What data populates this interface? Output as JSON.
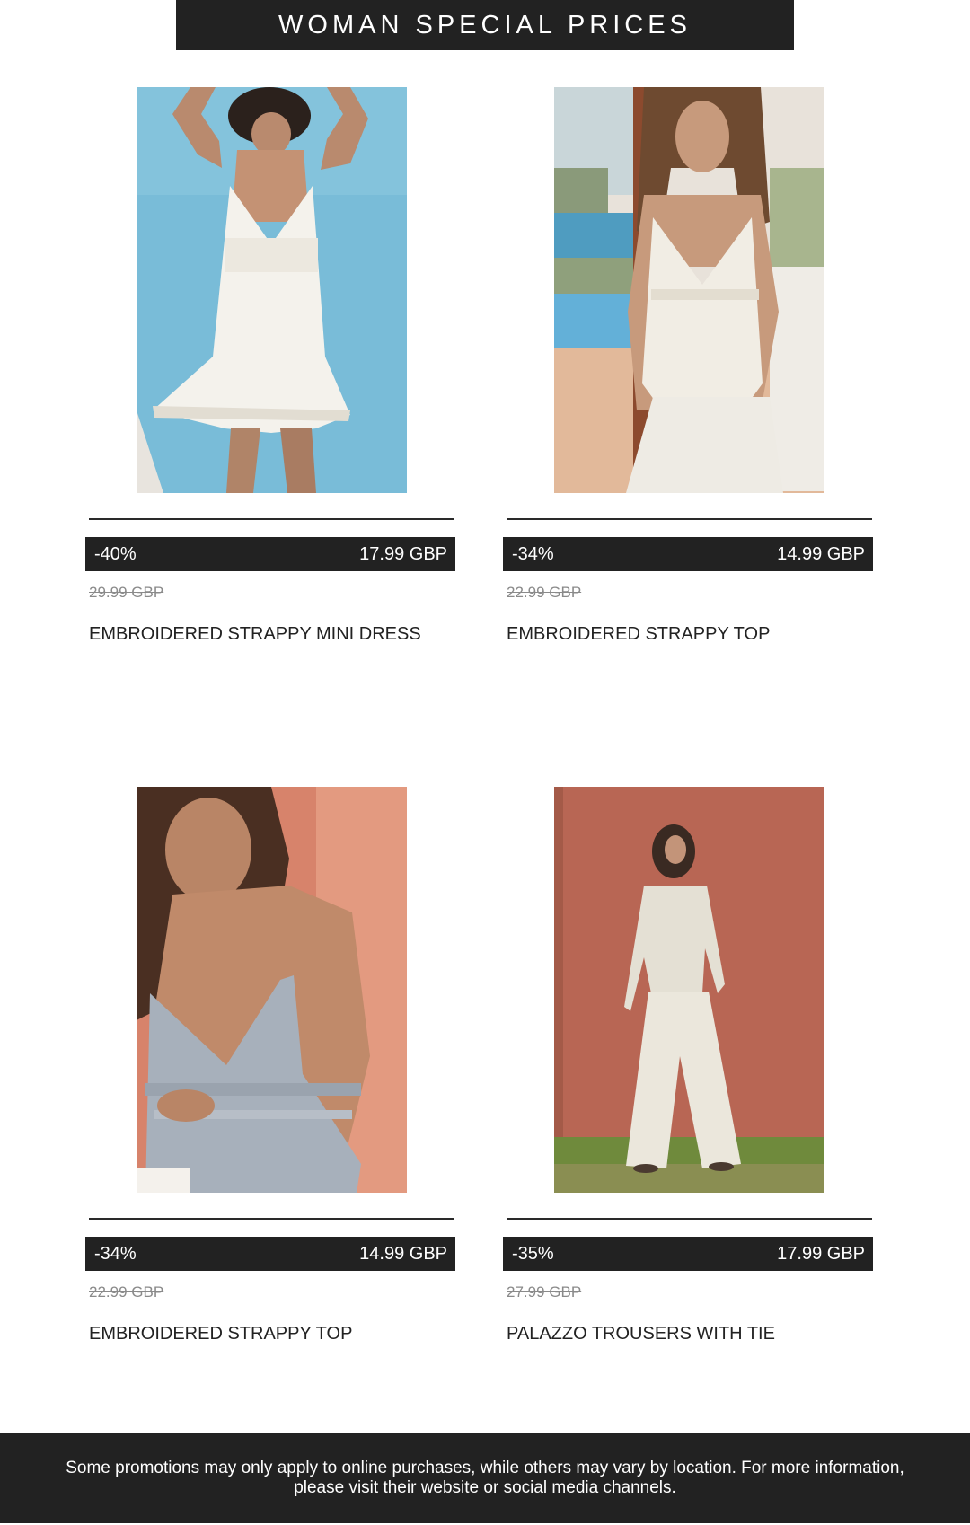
{
  "header": {
    "title": "WOMAN SPECIAL PRICES"
  },
  "products": [
    {
      "discount": "-40%",
      "price": "17.99 GBP",
      "old_price": "29.99 GBP",
      "name": "EMBROIDERED STRAPPY MINI DRESS",
      "image_alt": "Woman in white embroidered strappy mini dress"
    },
    {
      "discount": "-34%",
      "price": "14.99 GBP",
      "old_price": "22.99 GBP",
      "name": "EMBROIDERED STRAPPY TOP",
      "image_alt": "Woman in white embroidered strappy top and white trousers"
    },
    {
      "discount": "-34%",
      "price": "14.99 GBP",
      "old_price": "22.99 GBP",
      "name": "EMBROIDERED STRAPPY TOP",
      "image_alt": "Woman in blue-grey embroidered strappy top"
    },
    {
      "discount": "-35%",
      "price": "17.99 GBP",
      "old_price": "27.99 GBP",
      "name": "PALAZZO TROUSERS WITH TIE",
      "image_alt": "Woman in beige wrap top and palazzo trousers"
    }
  ],
  "footer": {
    "text": "Some promotions may only apply to online purchases, while others may vary by location. For more information,\nplease visit their website or social media channels."
  },
  "colors": {
    "banner_background": "#222222",
    "banner_text": "#ffffff",
    "old_price": "#8a8a8a"
  }
}
